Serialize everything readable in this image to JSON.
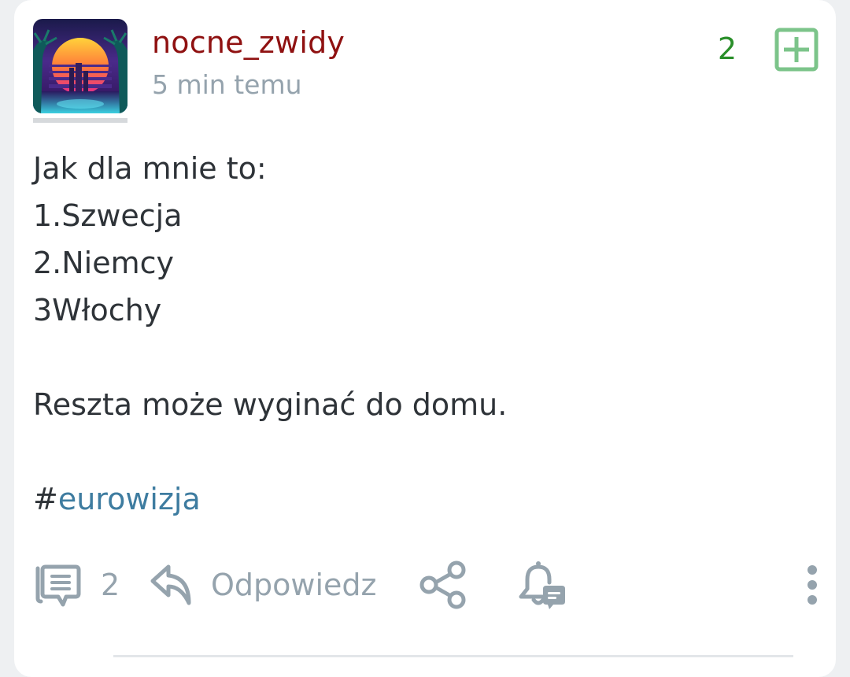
{
  "post": {
    "username": "nocne_zwidy",
    "timestamp": "5 min temu",
    "vote_count": "2",
    "content_lines": [
      "Jak dla mnie to:",
      "1.Szwecja",
      "2.Niemcy",
      "3Włochy",
      "",
      "Reszta może wyginać do domu.",
      ""
    ],
    "hashtag_symbol": "#",
    "hashtag": "eurowizja"
  },
  "actions": {
    "comments_count": "2",
    "reply_label": "Odpowiedz"
  },
  "icons": {
    "vote": "plus-square-icon",
    "comments": "comments-icon",
    "reply": "reply-arrow-icon",
    "share": "share-icon",
    "notify": "bell-comment-icon",
    "more": "more-vertical-icon"
  },
  "colors": {
    "username": "#8f1111",
    "vote": "#2a8f2a",
    "vote_icon": "#7cc48a",
    "muted": "#95a3ad",
    "hashtag": "#3e7ca0",
    "text": "#2e3338"
  }
}
